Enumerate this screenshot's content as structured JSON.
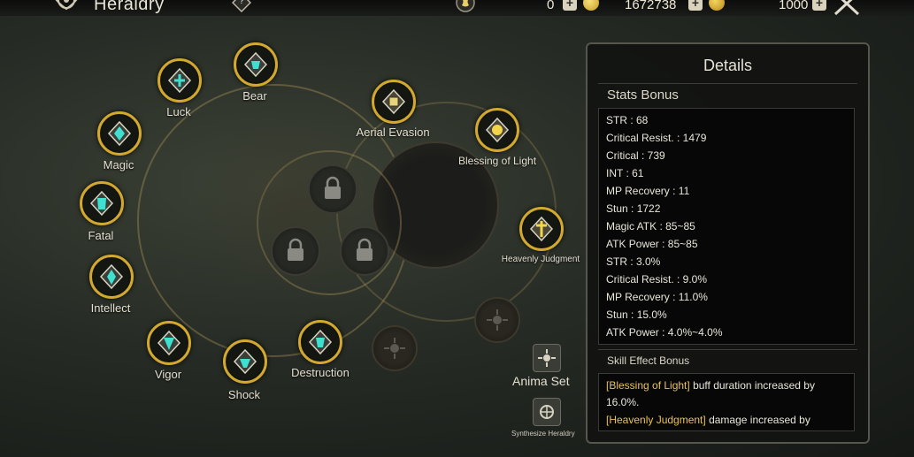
{
  "header": {
    "title": "Heraldry",
    "currencies": [
      {
        "value": "0",
        "icon": "crystal-icon"
      },
      {
        "value": "1672738",
        "icon": "gold-coin-icon"
      },
      {
        "value": "1000",
        "icon": "token-coin-icon"
      }
    ]
  },
  "nodes": [
    {
      "label": "Bear",
      "icon": "bear-emblem-icon"
    },
    {
      "label": "Luck",
      "icon": "luck-emblem-icon"
    },
    {
      "label": "Magic",
      "icon": "magic-emblem-icon"
    },
    {
      "label": "Fatal",
      "icon": "fatal-emblem-icon"
    },
    {
      "label": "Intellect",
      "icon": "intellect-emblem-icon"
    },
    {
      "label": "Vigor",
      "icon": "vigor-emblem-icon"
    },
    {
      "label": "Shock",
      "icon": "shock-emblem-icon"
    },
    {
      "label": "Destruction",
      "icon": "destruction-emblem-icon"
    },
    {
      "label": "Aerial Evasion",
      "icon": "aerial-evasion-emblem-icon"
    },
    {
      "label": "Blessing of Light",
      "icon": "blessing-emblem-icon"
    },
    {
      "label": "Heavenly Judgment",
      "icon": "heavenly-judgment-emblem-icon"
    }
  ],
  "side_buttons": {
    "anima_set": "Anima Set",
    "synthesize": "Synthesize Heraldry"
  },
  "details": {
    "title": "Details",
    "stats_title": "Stats Bonus",
    "stats": [
      "STR : 68",
      "Critical Resist. : 1479",
      "Critical : 739",
      "INT : 61",
      "MP Recovery : 11",
      "Stun : 1722",
      "Magic ATK : 85~85",
      "ATK Power : 85~85",
      "STR : 3.0%",
      "Critical Resist. : 9.0%",
      "MP Recovery : 11.0%",
      "Stun : 15.0%",
      "ATK Power : 4.0%~4.0%"
    ],
    "skill_title": "Skill Effect Bonus",
    "skill_effects": [
      {
        "skill": "[Blessing of Light]",
        "text1": " buff duration ",
        "text2": "increased by 16.0%."
      },
      {
        "skill": "[Heavenly Judgment]",
        "text1": " damage ",
        "text2": "increased by"
      }
    ]
  },
  "colors": {
    "gold_ring": "#d2a82e",
    "accent_teal": "#3fe0d0",
    "highlight": "#e8c15a"
  }
}
